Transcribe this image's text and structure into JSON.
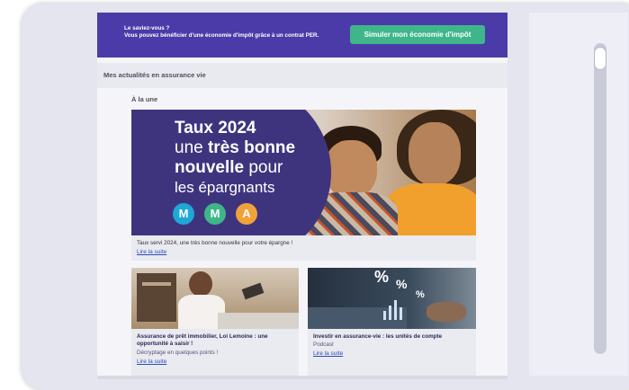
{
  "promo": {
    "line1": "Le saviez-vous ?",
    "line2": "Vous pouvez bénéficier d'une économie d'impôt grâce à un contrat PER.",
    "button_label": "Simuler mon économie d'impôt",
    "bg_color": "#4a3ba8",
    "button_color": "#3fb68a"
  },
  "section": {
    "title": "Mes actualités en assurance vie",
    "subtitle": "À la une"
  },
  "featured": {
    "hero_line1": "Taux 2024",
    "hero_line2_pre": "une ",
    "hero_line2_bold": "très bonne",
    "hero_line3_bold": "nouvelle",
    "hero_line3_post": " pour",
    "hero_line4": "les épargnants",
    "logo_letters": [
      "M",
      "M",
      "A"
    ],
    "title": "Taux servi 2024, une très bonne nouvelle pour votre épargne !",
    "link": "Lire la suite"
  },
  "articles": [
    {
      "title_line1": "Assurance de prêt immobilier, Loi Lemoine : une",
      "title_line2": "opportunité à saisir !",
      "subtitle": "Décryptage en quelques points !",
      "link": "Lire la suite"
    },
    {
      "title_line1": "Investir en assurance-vie : les unités de compte",
      "subtitle": "Podcast",
      "link": "Lire la suite"
    }
  ],
  "thumb_symbols": [
    "%",
    "%",
    "%"
  ]
}
